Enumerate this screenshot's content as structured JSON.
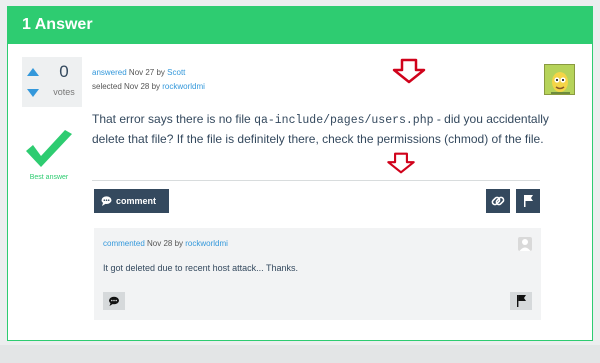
{
  "header": {
    "title": "1 Answer"
  },
  "vote": {
    "count": "0",
    "label": "votes"
  },
  "best": {
    "label": "Best answer"
  },
  "answer": {
    "answered_label": "answered",
    "answered_date": " Nov 27 by ",
    "author": "Scott",
    "selected_label": "selected Nov 28 by ",
    "selected_by": "rockworldmi",
    "text_pre": "That error says there is no file ",
    "text_code": "qa-include/pages/users.php",
    "text_post": " - did you accidentally delete that file? If the file is definitely there, check the permissions (chmod) of the file."
  },
  "actions": {
    "comment_label": "comment"
  },
  "comment": {
    "commented_label": "commented",
    "commented_date": " Nov 28 by ",
    "author": "rockworldmi",
    "text": "It got deleted due to recent host attack...  Thanks."
  },
  "colors": {
    "accent": "#2ecc71",
    "dark": "#34495e",
    "link": "#3498db",
    "annotation": "#d0021b"
  },
  "icons": [
    "chat-bubble-icon",
    "link-icon",
    "flag-icon",
    "checkmark-icon",
    "down-arrow-icon"
  ]
}
